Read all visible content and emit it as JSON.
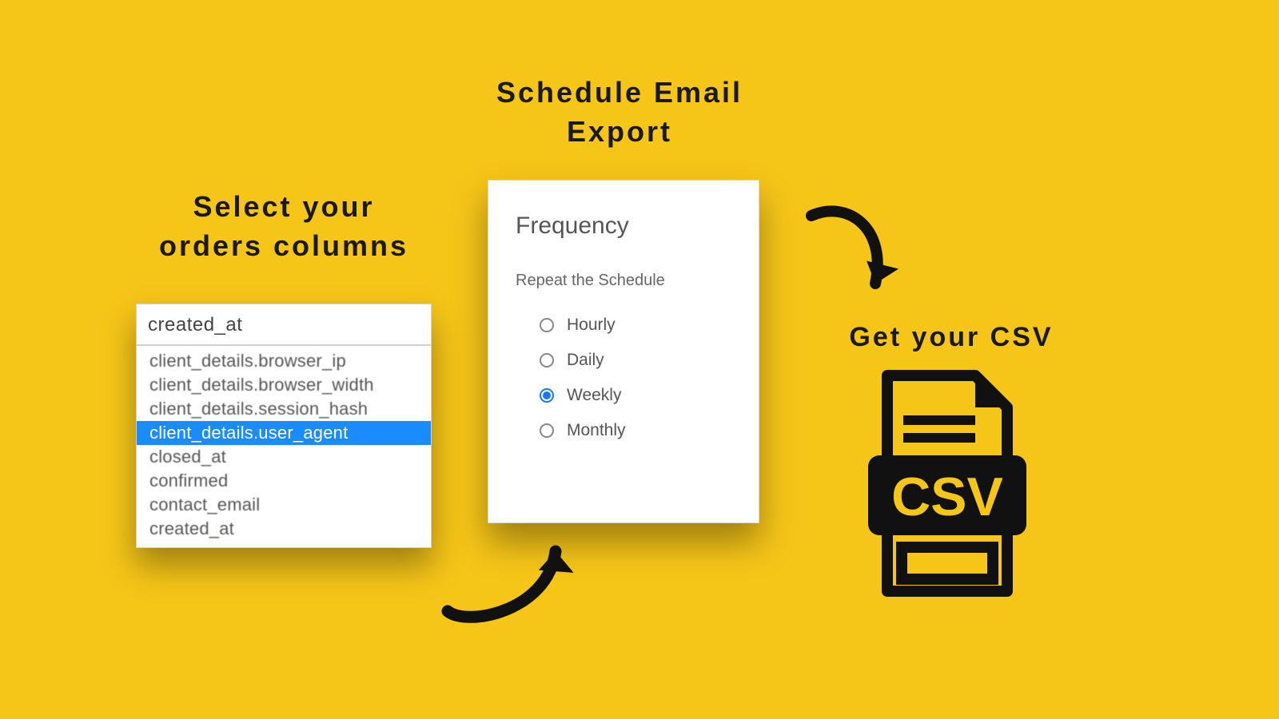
{
  "headings": {
    "left": "Select your orders columns",
    "center": "Schedule Email Export",
    "right": "Get your CSV"
  },
  "columns": {
    "search_value": "created_at",
    "items": [
      {
        "label": "client_details.browser_ip",
        "selected": false
      },
      {
        "label": "client_details.browser_width",
        "selected": false
      },
      {
        "label": "client_details.session_hash",
        "selected": false
      },
      {
        "label": "client_details.user_agent",
        "selected": true
      },
      {
        "label": "closed_at",
        "selected": false
      },
      {
        "label": "confirmed",
        "selected": false
      },
      {
        "label": "contact_email",
        "selected": false
      },
      {
        "label": "created_at",
        "selected": false
      }
    ]
  },
  "frequency": {
    "title": "Frequency",
    "subtitle": "Repeat the Schedule",
    "options": [
      {
        "label": "Hourly",
        "checked": false
      },
      {
        "label": "Daily",
        "checked": false
      },
      {
        "label": "Weekly",
        "checked": true
      },
      {
        "label": "Monthly",
        "checked": false
      }
    ]
  },
  "csv_badge": "CSV",
  "colors": {
    "background": "#f5c518",
    "dark": "#1a1a1a",
    "highlight": "#1a8cff",
    "radio_active": "#1976ff"
  }
}
